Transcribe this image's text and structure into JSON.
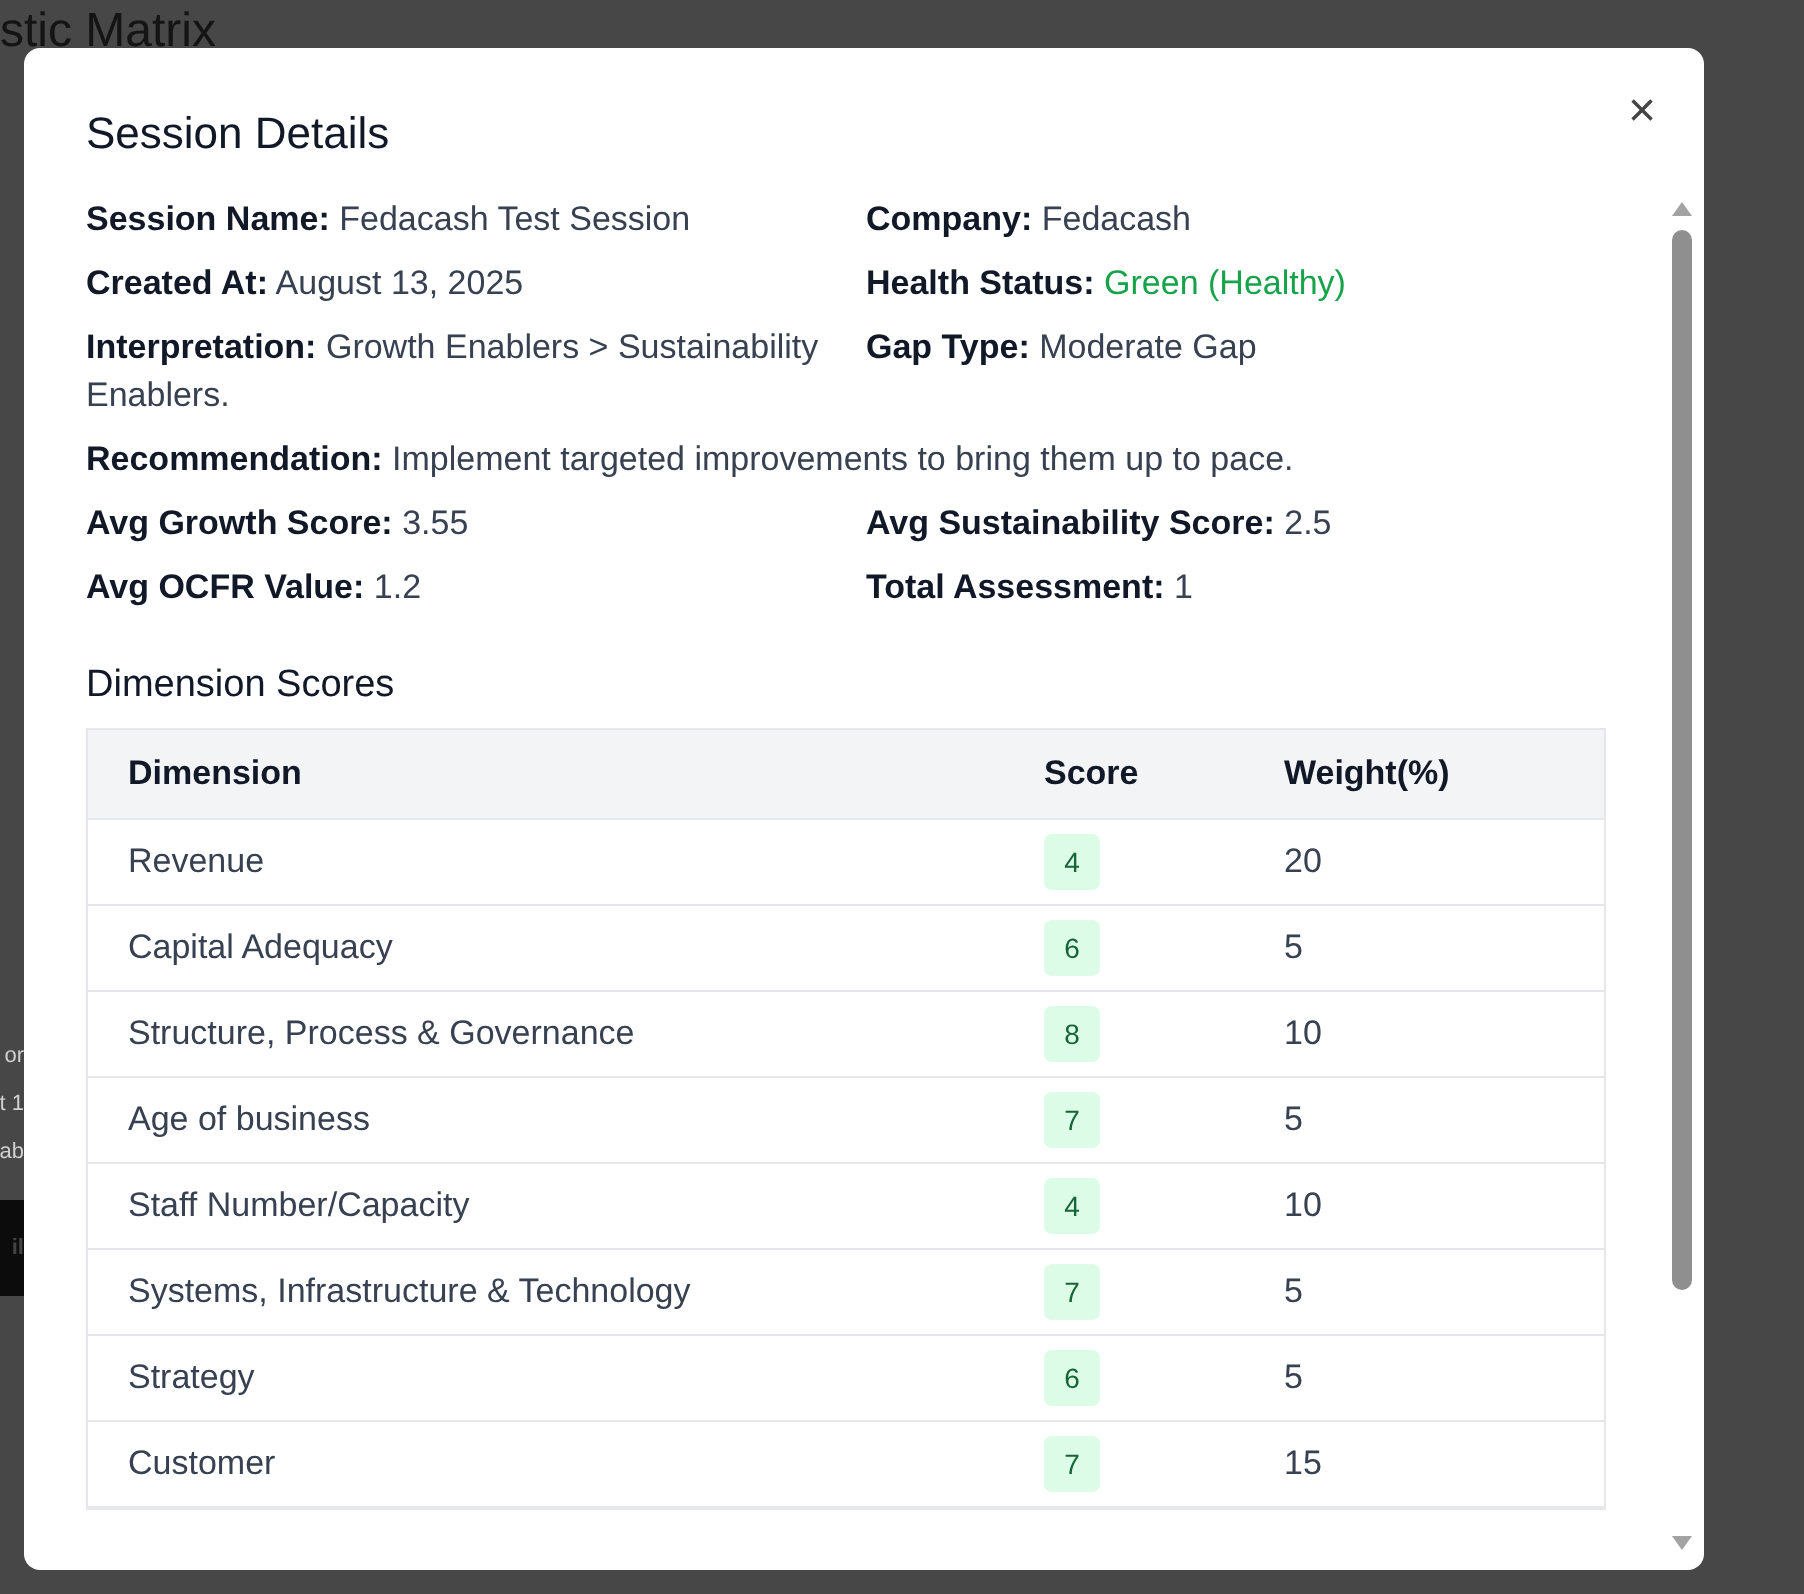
{
  "background": {
    "title": "stic Matrix",
    "fragments": [
      "or",
      "t 1",
      "ab"
    ],
    "button": "il"
  },
  "dialog": {
    "title": "Session Details",
    "close": "×",
    "fields": [
      {
        "label": "Session Name:",
        "value": "Fedacash Test Session",
        "kind": "half"
      },
      {
        "label": "Company:",
        "value": "Fedacash",
        "kind": "half"
      },
      {
        "label": "Created At:",
        "value": "August 13, 2025",
        "kind": "half"
      },
      {
        "label": "Health Status:",
        "value": "Green (Healthy)",
        "kind": "status"
      },
      {
        "label": "Interpretation:",
        "value": "Growth Enablers > Sustainability Enablers.",
        "kind": "half"
      },
      {
        "label": "Gap Type:",
        "value": "Moderate Gap",
        "kind": "half"
      },
      {
        "label": "Recommendation:",
        "value": "Implement targeted improvements to bring them up to pace.",
        "kind": "wide"
      },
      {
        "label": "Avg Growth Score:",
        "value": "3.55",
        "kind": "half"
      },
      {
        "label": "Avg Sustainability Score:",
        "value": "2.5",
        "kind": "half"
      },
      {
        "label": "Avg OCFR Value:",
        "value": "1.2",
        "kind": "half"
      },
      {
        "label": "Total Assessment:",
        "value": "1",
        "kind": "half"
      }
    ],
    "section_title": "Dimension Scores",
    "table": {
      "columns": [
        "Dimension",
        "Score",
        "Weight(%)"
      ],
      "rows": [
        {
          "dimension": "Revenue",
          "score": "4",
          "weight": "20"
        },
        {
          "dimension": "Capital Adequacy",
          "score": "6",
          "weight": "5"
        },
        {
          "dimension": "Structure, Process & Governance",
          "score": "8",
          "weight": "10"
        },
        {
          "dimension": "Age of business",
          "score": "7",
          "weight": "5"
        },
        {
          "dimension": "Staff Number/Capacity",
          "score": "4",
          "weight": "10"
        },
        {
          "dimension": "Systems, Infrastructure & Technology",
          "score": "7",
          "weight": "5"
        },
        {
          "dimension": "Strategy",
          "score": "6",
          "weight": "5"
        },
        {
          "dimension": "Customer",
          "score": "7",
          "weight": "15"
        }
      ]
    }
  }
}
